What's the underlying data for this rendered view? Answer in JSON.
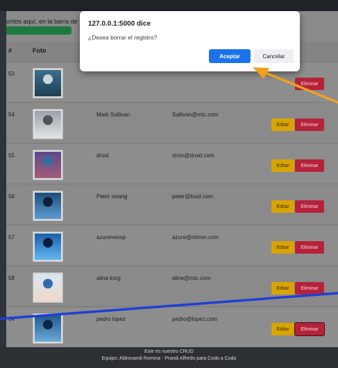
{
  "page": {
    "bookmark_hint_prefix": "oritos aquí, en la barra de",
    "table_headers": {
      "id": "#",
      "photo": "Foto"
    }
  },
  "rows": [
    {
      "id": "53",
      "name": "",
      "email": "",
      "edit_label": "",
      "delete_label": "Eliminar",
      "thumb_colors": [
        "#3b6f8a",
        "#c8d6e0",
        "#1e3f55"
      ]
    },
    {
      "id": "54",
      "name": "Mark Sullivan",
      "email": "Sullivan@mtc.com",
      "edit_label": "Editar",
      "delete_label": "Eliminar",
      "thumb_colors": [
        "#9aa1a8",
        "#4d5358",
        "#dfe2e5"
      ]
    },
    {
      "id": "55",
      "name": "droid",
      "email": "droix@droid.com",
      "edit_label": "Editar",
      "delete_label": "Eliminar",
      "thumb_colors": [
        "#5b4a8c",
        "#2e6f9e",
        "#a35a7a"
      ]
    },
    {
      "id": "56",
      "name": "Peter swang",
      "email": "peter@loud.com",
      "edit_label": "Editar",
      "delete_label": "Eliminar",
      "thumb_colors": [
        "#1f4e7a",
        "#0d2038",
        "#5d9bd1"
      ]
    },
    {
      "id": "57",
      "name": "azureneonp",
      "email": "azure@mimm.com",
      "edit_label": "Editar",
      "delete_label": "Eliminar",
      "thumb_colors": [
        "#1b5fa8",
        "#0b1c3d",
        "#62b7f0"
      ]
    },
    {
      "id": "58",
      "name": "alina korg",
      "email": "aline@mtx.com",
      "edit_label": "Editar",
      "delete_label": "Eliminar",
      "thumb_colors": [
        "#d9e6f0",
        "#2f6db0",
        "#f0d8c8"
      ]
    },
    {
      "id": "64",
      "name": "pedro lopez",
      "email": "pedro@lopez.com",
      "edit_label": "Editar",
      "delete_label": "Eliminar",
      "thumb_colors": [
        "#215a8f",
        "#0e2844",
        "#6aa8d8"
      ]
    }
  ],
  "dialog": {
    "title": "127.0.0.1:5000 dice",
    "message": "¿Desea borrar el registro?",
    "ok_label": "Aceptar",
    "cancel_label": "Cancelar"
  },
  "footer": {
    "line1": "Este es nuestro CRUD",
    "line2": "Equipo: Aldrovandi Romina - Prandi Alfredo para Codo a Codo",
    "line3": ""
  },
  "colors": {
    "edit_button": "#ffc107",
    "delete_button": "#dc3545",
    "dialog_ok": "#1a73e8",
    "annotation_arrow": "#f5a623",
    "annotation_line": "#1f3fd6"
  },
  "annotations": {
    "arrow_icon": "arrow-annotation-icon",
    "line_icon": "line-annotation-icon"
  }
}
